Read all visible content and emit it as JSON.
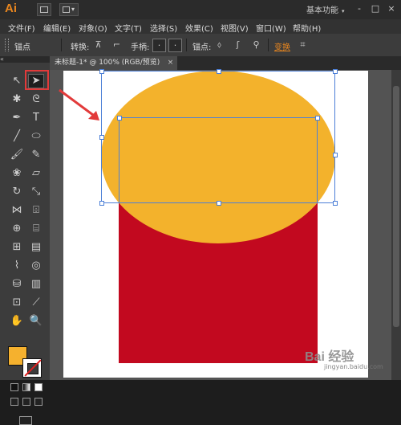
{
  "app": {
    "logo": "Ai",
    "workspace": "基本功能",
    "win_min": "-",
    "win_max": "□",
    "win_close": "×"
  },
  "menu": [
    "文件(F)",
    "编辑(E)",
    "对象(O)",
    "文字(T)",
    "选择(S)",
    "效果(C)",
    "视图(V)",
    "窗口(W)",
    "帮助(H)"
  ],
  "control": {
    "anchor_label": "锚点",
    "convert_label": "转换:",
    "handles_label": "手柄:",
    "anchor2_label": "锚点:",
    "transform_label": "变换"
  },
  "document_tab": {
    "title": "未标题-1* @ 100% (RGB/预览)",
    "close": "×"
  },
  "colors": {
    "fill": "#f3b22c",
    "rect": "#c2091f",
    "selection": "#4c7fd7",
    "highlight": "#e23a3a",
    "accent": "#e8861f"
  },
  "tools": [
    [
      "selection-icon",
      "direct-selection-icon"
    ],
    [
      "magic-wand-icon",
      "lasso-icon"
    ],
    [
      "pen-icon",
      "type-icon"
    ],
    [
      "line-icon",
      "ellipse-icon"
    ],
    [
      "paintbrush-icon",
      "pencil-icon"
    ],
    [
      "blob-brush-icon",
      "eraser-icon"
    ],
    [
      "rotate-icon",
      "scale-icon"
    ],
    [
      "width-icon",
      "free-transform-icon"
    ],
    [
      "shape-builder-icon",
      "perspective-grid-icon"
    ],
    [
      "mesh-icon",
      "gradient-icon"
    ],
    [
      "eyedropper-icon",
      "blend-icon"
    ],
    [
      "symbol-sprayer-icon",
      "column-graph-icon"
    ],
    [
      "artboard-icon",
      "slice-icon"
    ],
    [
      "hand-icon",
      "zoom-icon"
    ]
  ],
  "watermark": {
    "text": "Bai 经验",
    "sub": "jingyan.baidu.com"
  }
}
